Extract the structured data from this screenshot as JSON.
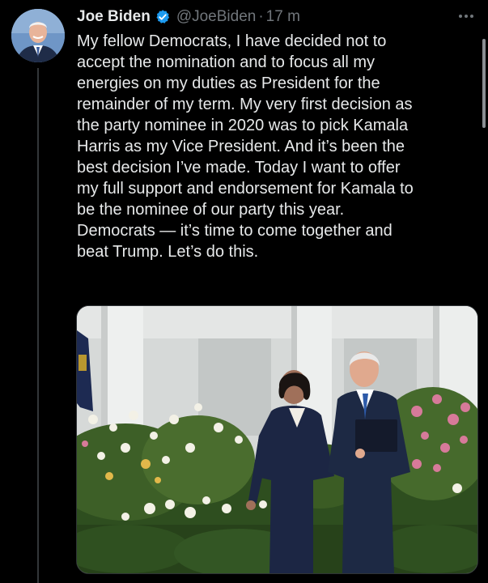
{
  "tweet": {
    "author_name": "Joe Biden",
    "handle": "@JoeBiden",
    "separator": "·",
    "time": "17 m",
    "text_lines": [
      "My fellow Democrats, I have decided not to",
      "accept the nomination and to focus all my",
      "energies on my duties as President for the",
      "remainder of my term. My very first decision as",
      "the party nominee in 2020 was to pick Kamala",
      "Harris as my Vice President. And it’s been the",
      "best decision I’ve made. Today I want to offer",
      "my full support and endorsement for Kamala to",
      "be the nominee of our party this year.",
      "Democrats — it’s time to come together and",
      "beat Trump. Let’s do this."
    ]
  },
  "icons": {
    "avatar": "avatar-icon",
    "verified": "verified-badge-icon",
    "more": "more-horizontal-icon"
  },
  "colors": {
    "background": "#000000",
    "primary_text": "#e7e9ea",
    "secondary_text": "#71767b",
    "verified": "#1d9bf0",
    "thread_line": "#333639"
  }
}
